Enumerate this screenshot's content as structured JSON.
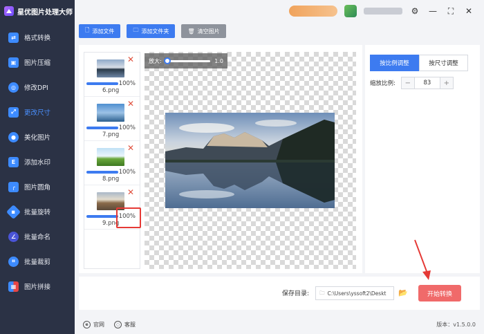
{
  "app": {
    "title": "星优图片处理大师"
  },
  "sidebar": {
    "items": [
      {
        "label": "格式转换",
        "icon": "format-convert-icon",
        "color": "#3d8bff"
      },
      {
        "label": "图片压缩",
        "icon": "compress-icon",
        "color": "#3d8bff"
      },
      {
        "label": "修改DPI",
        "icon": "dpi-icon",
        "color": "#3d8bff"
      },
      {
        "label": "更改尺寸",
        "icon": "resize-icon",
        "color": "#3d8bff",
        "active": true
      },
      {
        "label": "美化图片",
        "icon": "beautify-icon",
        "color": "#3d8bff"
      },
      {
        "label": "添加水印",
        "icon": "watermark-icon",
        "color": "#3d8bff"
      },
      {
        "label": "图片圆角",
        "icon": "round-corner-icon",
        "color": "#3d8bff"
      },
      {
        "label": "批量旋转",
        "icon": "rotate-icon",
        "color": "#3d8bff"
      },
      {
        "label": "批量命名",
        "icon": "rename-icon",
        "color": "#4a54d6"
      },
      {
        "label": "批量裁剪",
        "icon": "crop-icon",
        "color": "#3d8bff"
      },
      {
        "label": "图片拼接",
        "icon": "stitch-icon",
        "color": "#e64545"
      }
    ]
  },
  "toolbar": {
    "add_file": "添加文件",
    "add_folder": "添加文件夹",
    "clear": "清空图片"
  },
  "files": [
    {
      "name": "6.png",
      "progress": "100%"
    },
    {
      "name": "7.png",
      "progress": "100%"
    },
    {
      "name": "8.png",
      "progress": "100%"
    },
    {
      "name": "9.png",
      "progress": "100%"
    }
  ],
  "preview": {
    "zoom_label": "放大:",
    "zoom_value": "1.0",
    "zoom_level": 0.0
  },
  "resize_panel": {
    "tab_ratio": "按比例调整",
    "tab_size": "按尺寸调整",
    "scale_label": "缩放比例:",
    "scale_value": "83",
    "minus": "−",
    "plus": "+"
  },
  "output": {
    "save_label": "保存目录:",
    "save_path": "C:\\Users\\yssoft2\\Deskt",
    "start_button": "开始转换"
  },
  "footer": {
    "website": "官网",
    "support": "客服",
    "version": "版本：v1.5.0.0"
  },
  "colors": {
    "accent": "#3d7bf0",
    "sidebar_bg": "#2b3245",
    "start_button": "#f06a6a",
    "highlight": "#e53935"
  }
}
